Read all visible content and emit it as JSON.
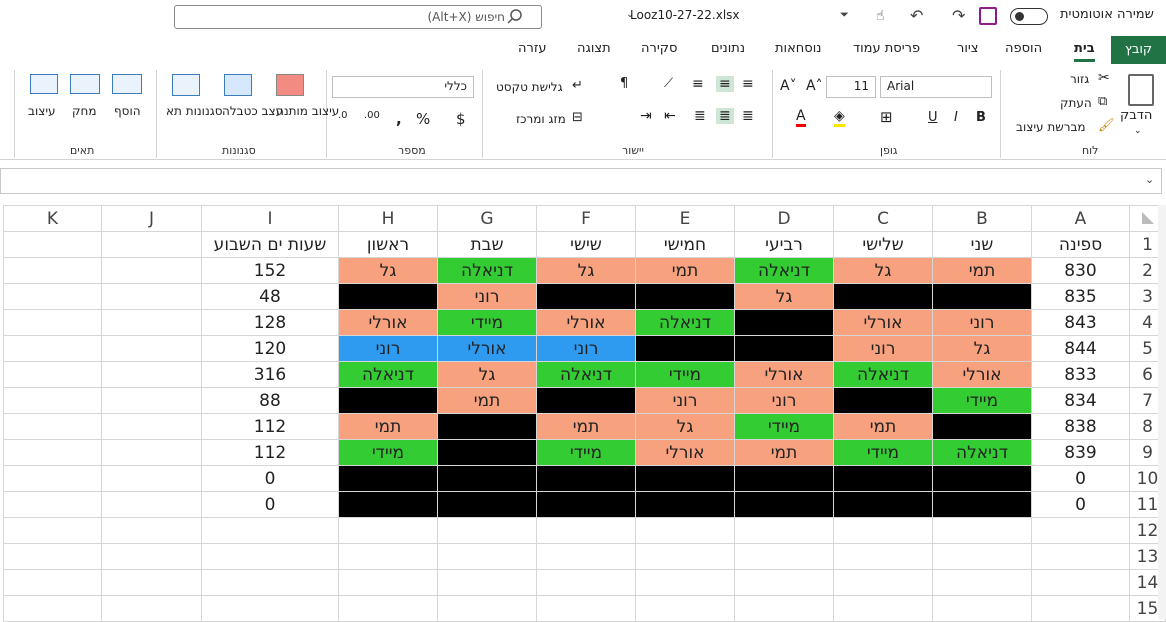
{
  "titlebar": {
    "search_placeholder": "חיפוש (Alt+X)",
    "filename": "Looz10-27-22.xlsx",
    "autosave_label": "שמירה אוטומטית"
  },
  "tabs": [
    "קובץ",
    "בית",
    "הוספה",
    "ציור",
    "פריסת עמוד",
    "נוסחאות",
    "נתונים",
    "סקירה",
    "תצוגה",
    "עזרה"
  ],
  "ribbon": {
    "clipboard": {
      "label": "לוח",
      "paste": "הדבק",
      "cut": "גזור",
      "copy": "העתק",
      "format_painter": "מברשת עיצוב"
    },
    "font": {
      "label": "גופן",
      "font_name": "Arial",
      "font_size": "11"
    },
    "alignment": {
      "label": "יישור",
      "wrap": "גלישת טקסט",
      "merge": "מזג ומרכז"
    },
    "number": {
      "label": "מספר",
      "format": "כללי"
    },
    "styles": {
      "label": "סגנונות",
      "conditional": "עיצוב מותנה",
      "table": "עצב כטבלה",
      "cell": "סגנונות תא"
    },
    "cells": {
      "label": "תאים",
      "insert": "הוסף",
      "delete": "מחק",
      "format": "עיצוב"
    }
  },
  "columns": [
    "A",
    "B",
    "C",
    "D",
    "E",
    "F",
    "G",
    "H",
    "I",
    "J",
    "K"
  ],
  "rows": [
    {
      "n": "1",
      "cells": [
        "ספינה",
        "שני",
        "שלישי",
        "רביעי",
        "חמישי",
        "שישי",
        "שבת",
        "ראשון",
        "שעות ים השבוע",
        "",
        ""
      ]
    },
    {
      "n": "2",
      "cells": [
        "830",
        "תמי",
        "גל",
        "דניאלה",
        "תמי",
        "גל",
        "דניאלה",
        "גל",
        "152",
        "",
        ""
      ]
    },
    {
      "n": "3",
      "cells": [
        "835",
        "",
        "",
        "גל",
        "",
        "",
        "רוני",
        "",
        "48",
        "",
        ""
      ]
    },
    {
      "n": "4",
      "cells": [
        "843",
        "רוני",
        "אורלי",
        "",
        "דניאלה",
        "אורלי",
        "מיידי",
        "אורלי",
        "128",
        "",
        ""
      ]
    },
    {
      "n": "5",
      "cells": [
        "844",
        "גל",
        "רוני",
        "",
        "",
        "רוני",
        "אורלי",
        "רוני",
        "120",
        "",
        ""
      ]
    },
    {
      "n": "6",
      "cells": [
        "833",
        "אורלי",
        "דניאלה",
        "אורלי",
        "מיידי",
        "דניאלה",
        "גל",
        "דניאלה",
        "316",
        "",
        ""
      ]
    },
    {
      "n": "7",
      "cells": [
        "834",
        "מיידי",
        "",
        "רוני",
        "רוני",
        "",
        "תמי",
        "",
        "88",
        "",
        ""
      ]
    },
    {
      "n": "8",
      "cells": [
        "838",
        "",
        "תמי",
        "מיידי",
        "גל",
        "תמי",
        "",
        "תמי",
        "112",
        "",
        ""
      ]
    },
    {
      "n": "9",
      "cells": [
        "839",
        "דניאלה",
        "מיידי",
        "תמי",
        "אורלי",
        "מיידי",
        "",
        "מיידי",
        "112",
        "",
        ""
      ]
    },
    {
      "n": "10",
      "cells": [
        "0",
        "",
        "",
        "",
        "",
        "",
        "",
        "",
        "0",
        "",
        ""
      ]
    },
    {
      "n": "11",
      "cells": [
        "0",
        "",
        "",
        "",
        "",
        "",
        "",
        "",
        "0",
        "",
        ""
      ]
    },
    {
      "n": "12",
      "cells": [
        "",
        "",
        "",
        "",
        "",
        "",
        "",
        "",
        "",
        "",
        ""
      ]
    },
    {
      "n": "13",
      "cells": [
        "",
        "",
        "",
        "",
        "",
        "",
        "",
        "",
        "",
        "",
        ""
      ]
    },
    {
      "n": "14",
      "cells": [
        "",
        "",
        "",
        "",
        "",
        "",
        "",
        "",
        "",
        "",
        ""
      ]
    },
    {
      "n": "15",
      "cells": [
        "",
        "",
        "",
        "",
        "",
        "",
        "",
        "",
        "",
        "",
        ""
      ]
    }
  ],
  "fills": [
    [
      "",
      "",
      "",
      "",
      "",
      "",
      "",
      "",
      "",
      "",
      ""
    ],
    [
      "",
      "salmon",
      "salmon",
      "green",
      "salmon",
      "salmon",
      "green",
      "salmon",
      "",
      "",
      ""
    ],
    [
      "",
      "black",
      "black",
      "salmon",
      "black",
      "black",
      "salmon",
      "black",
      "",
      "",
      ""
    ],
    [
      "",
      "salmon",
      "salmon",
      "black",
      "green",
      "salmon",
      "green",
      "salmon",
      "",
      "",
      ""
    ],
    [
      "",
      "salmon",
      "salmon",
      "black",
      "black",
      "blue",
      "blue",
      "blue",
      "",
      "",
      ""
    ],
    [
      "",
      "salmon",
      "green",
      "salmon",
      "green",
      "green",
      "salmon",
      "green",
      "",
      "",
      ""
    ],
    [
      "",
      "green",
      "black",
      "salmon",
      "salmon",
      "black",
      "salmon",
      "black",
      "",
      "",
      ""
    ],
    [
      "",
      "black",
      "salmon",
      "green",
      "salmon",
      "salmon",
      "black",
      "salmon",
      "",
      "",
      ""
    ],
    [
      "",
      "green",
      "green",
      "salmon",
      "salmon",
      "green",
      "black",
      "green",
      "",
      "",
      ""
    ],
    [
      "",
      "black",
      "black",
      "black",
      "black",
      "black",
      "black",
      "black",
      "",
      "",
      ""
    ],
    [
      "",
      "black",
      "black",
      "black",
      "black",
      "black",
      "black",
      "black",
      "",
      "",
      ""
    ],
    [
      "",
      "",
      "",
      "",
      "",
      "",
      "",
      "",
      "",
      "",
      ""
    ],
    [
      "",
      "",
      "",
      "",
      "",
      "",
      "",
      "",
      "",
      "",
      ""
    ],
    [
      "",
      "",
      "",
      "",
      "",
      "",
      "",
      "",
      "",
      "",
      ""
    ],
    [
      "",
      "",
      "",
      "",
      "",
      "",
      "",
      "",
      "",
      "",
      ""
    ]
  ],
  "colors": {
    "excel_green": "#217346",
    "salmon": "#f8a17f",
    "green": "#33cc33",
    "black": "#000000",
    "blue": "#2e9bf0"
  }
}
